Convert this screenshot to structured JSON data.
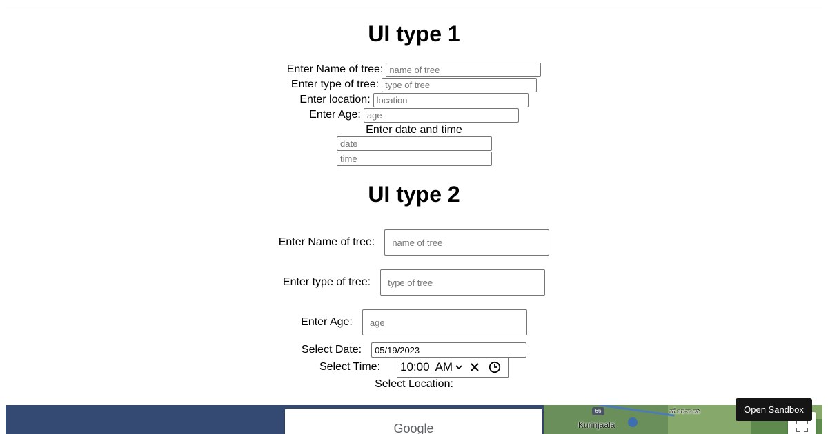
{
  "ui1": {
    "title": "UI type 1",
    "fields": [
      {
        "label": "Enter Name of tree:",
        "placeholder": "name of tree"
      },
      {
        "label": "Enter type of tree:",
        "placeholder": "type of tree"
      },
      {
        "label": "Enter location:",
        "placeholder": "location"
      },
      {
        "label": "Enter Age:",
        "placeholder": "age"
      }
    ],
    "datetime_label": "Enter date and time",
    "date_placeholder": "date",
    "time_placeholder": "time"
  },
  "ui2": {
    "title": "UI type 2",
    "fields": [
      {
        "label": "Enter Name of tree:",
        "placeholder": "name of tree"
      },
      {
        "label": "Enter type of tree:",
        "placeholder": "type of tree"
      },
      {
        "label": "Enter Age:",
        "placeholder": "age"
      }
    ],
    "date_label": "Select Date:",
    "date_value": "05/19/2023",
    "time_label": "Select Time:",
    "time_value": "10:00",
    "time_period": "AM",
    "location_label": "Select Location:"
  },
  "map": {
    "provider_label": "Google",
    "road_number": "66",
    "place_labels": [
      "Kurinjaala",
      "ಹೊರನಾಡು"
    ],
    "colors": {
      "water": "#354a72",
      "land": "#6b8f5b"
    }
  },
  "sandbox": {
    "label": "Open Sandbox"
  },
  "icons": [
    "chevron-down-icon",
    "clear-icon",
    "clock-icon",
    "fullscreen-icon"
  ]
}
